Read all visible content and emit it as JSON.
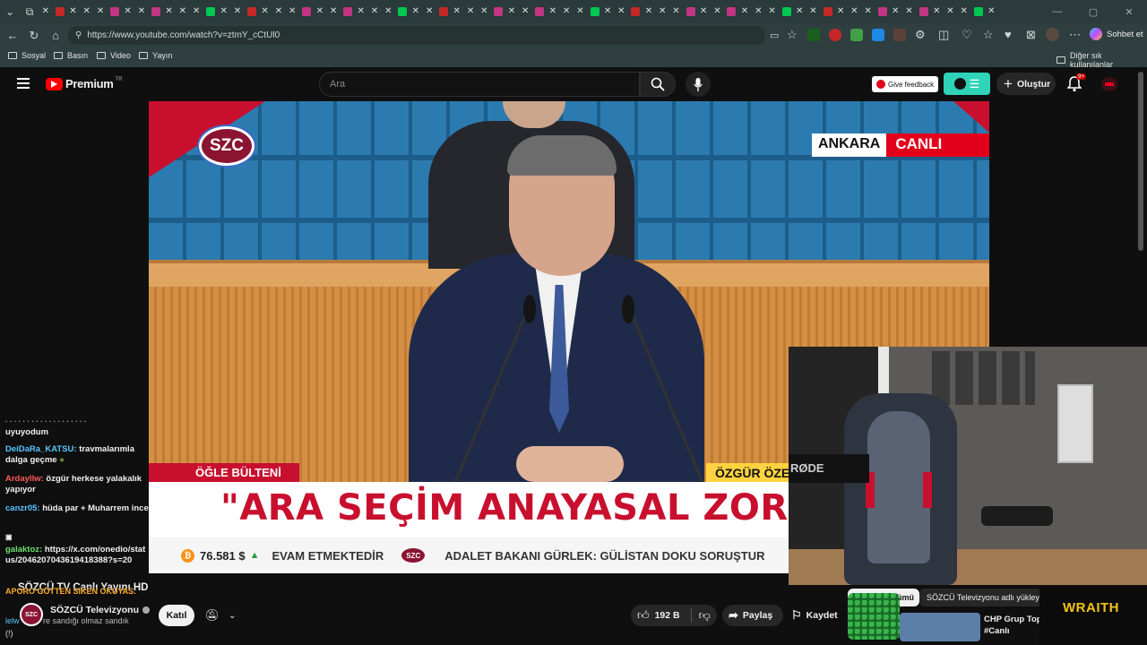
{
  "browser": {
    "url": "https://www.youtube.com/watch?v=ztmY_cCtUl0",
    "profile_button": "Sohbet et",
    "bookmarks": [
      "Sosyal",
      "Basın",
      "Video",
      "Yayın"
    ],
    "other_bookmarks": "Diğer sık kullanılanlar"
  },
  "youtube": {
    "logo_text": "Premium",
    "logo_region": "TR",
    "search_placeholder": "Ara",
    "feedback_label": "Give feedback",
    "create_label": "Oluştur",
    "notif_badge": "9+"
  },
  "video": {
    "channel_bug": "SZC",
    "location_tag": "ANKARA",
    "live_tag": "CANLI",
    "program_tag": "ÖĞLE BÜLTENİ",
    "speaker_tag": "ÖZGÜR ÖZE",
    "headline": "\"ARA SEÇİM ANAYASAL ZORUNI",
    "ticker_price": "76.581 $",
    "ticker_left": "EVAM ETMEKTEDİR",
    "ticker_logo": "SZC",
    "ticker_right": "ADALET BAKANI GÜRLEK: GÜLİSTAN DOKU SORUŞTUR"
  },
  "chat": {
    "messages": [
      {
        "user": "",
        "text": "uyuyodum"
      },
      {
        "user": "DeiDaRa_KATSU:",
        "text": "travmalarımla dalga geçme"
      },
      {
        "user": "Ardayllw:",
        "text": "özgür herkese yalakalık yapıyor"
      },
      {
        "user": "canzr05:",
        "text": "hüda par + Muharrem ince"
      },
      {
        "user": "galaktoz:",
        "text": "https://x.com/onedio/status/2046207043619418388?s=20"
      }
    ],
    "pinned": "APORO GÖTTEN SIKEN OKUYAS.",
    "footer_user": "lelw",
    "footer_text": "re sandığı olmaz sandık",
    "footer_extra": "(!)"
  },
  "below": {
    "title": "SÖZCÜ TV Canlı Yayını HD",
    "channel": "SÖZCÜ Televizyonu",
    "join_label": "Katıl",
    "likes": "192 B",
    "share_label": "Paylaş",
    "save_label": "Kaydet"
  },
  "sidebar": {
    "chip_all": "Tümü",
    "chip_channel": "SÖZCÜ Televizyonu adlı yükley",
    "rec_title_1": "CHP Grup Topl",
    "rec_title_2": "#Canlı"
  },
  "overlay": {
    "brand": "WRAITH",
    "mic_brand": "RØDE"
  },
  "colors": {
    "accent_red": "#e3001b",
    "chip_green": "#2fd3b8",
    "link_blue": "#57c7ff",
    "wraith_gold": "#f0c419"
  }
}
